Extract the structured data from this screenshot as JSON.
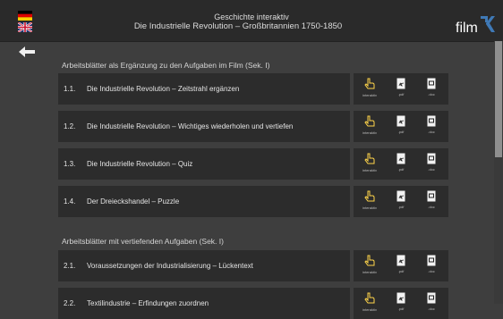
{
  "header": {
    "title_line1": "Geschichte interaktiv",
    "title_line2": "Die Industrielle Revolution – Großbritannien 1750-1850",
    "logo_text": "film"
  },
  "icons": {
    "back": "arrow-left-icon",
    "german_flag": "german-flag-icon",
    "uk_flag": "uk-flag-icon",
    "interaktiv": "hand-pointer-icon",
    "pdf": "pdf-file-icon",
    "doc": "doc-file-icon"
  },
  "colors": {
    "accent": "#3f79b6",
    "background": "#3e3e3e",
    "row": "#2c2c2c",
    "header": "#2a2a2a"
  },
  "sections": [
    {
      "title": "Arbeitsblätter als Ergänzung zu den Aufgaben im Film (Sek. I)",
      "items": [
        {
          "number": "1.1.",
          "label": "Die Industrielle Revolution – Zeitstrahl ergänzen"
        },
        {
          "number": "1.2.",
          "label": "Die Industrielle Revolution – Wichtiges wiederholen und vertiefen"
        },
        {
          "number": "1.3.",
          "label": "Die Industrielle Revolution – Quiz"
        },
        {
          "number": "1.4.",
          "label": "Der Dreieckshandel – Puzzle"
        }
      ]
    },
    {
      "title": "Arbeitsblätter mit vertiefenden Aufgaben (Sek. I)",
      "items": [
        {
          "number": "2.1.",
          "label": "Voraussetzungen der Industrialisierung – Lückentext"
        },
        {
          "number": "2.2.",
          "label": "Textilindustrie – Erfindungen zuordnen"
        }
      ]
    }
  ],
  "link_labels": {
    "interaktiv": "interaktiv",
    "pdf": ".pdf",
    "doc": ".doc"
  }
}
